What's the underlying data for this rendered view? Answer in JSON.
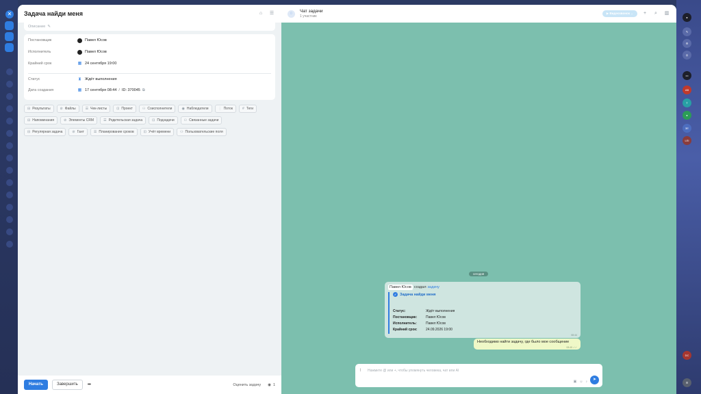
{
  "task": {
    "title": "Задача найди меня",
    "description_label": "Описание",
    "fields": {
      "creator_label": "Постановщик",
      "creator_value": "Павел Юсов",
      "assignee_label": "Исполнитель",
      "assignee_value": "Павел Юсов",
      "deadline_label": "Крайний срок",
      "deadline_value": "24 сентября 19:00",
      "status_label": "Статус",
      "status_value": "Ждёт выполнения",
      "created_label": "Дата создания",
      "created_value": "17 сентября 08:44",
      "id_value": "ID: 370045"
    },
    "chips_row1": [
      "Результаты",
      "Файлы",
      "Чек-листы",
      "Проект",
      "Соисполнители",
      "Наблюдатели",
      "Поток",
      "Теги"
    ],
    "chips_row2": [
      "Напоминания",
      "Элементы CRM",
      "Родительская задача",
      "Подзадачи",
      "Связанные задачи"
    ],
    "chips_row3": [
      "Регулярная задача",
      "Гант",
      "Планирование сроков",
      "Учёт времени",
      "Пользовательские поля"
    ],
    "footer": {
      "start_label": "Начать",
      "finish_label": "Завершить",
      "rate_label": "Оценить задачу",
      "views_count": "1"
    }
  },
  "chat": {
    "title": "Чат задачи",
    "subtitle": "1 участник",
    "video_label": "Видеозвонок",
    "date_label": "сегодня",
    "system_message": {
      "author": "Павел Юсов",
      "action": "создал",
      "link": "задачу",
      "task_title": "Задача найди меня",
      "rows": [
        {
          "key": "Статус:",
          "value": "Ждёт выполнения"
        },
        {
          "key": "Постановщик:",
          "value": "Павел Юсов"
        },
        {
          "key": "Исполнитель:",
          "value": "Павел Юсов"
        },
        {
          "key": "Крайний срок:",
          "value": "24.09.2026 19:00"
        }
      ],
      "time": "08:44"
    },
    "outgoing_message": {
      "text": "Необходимо найти задачу, где было мое сообщение",
      "time": "08:45"
    },
    "composer_placeholder": "Нажмите @ или +, чтобы упомянуть человека, чат или AI"
  },
  "right_rail": {
    "avatars": [
      "AB",
      "T",
      "3E",
      "LEI",
      "DC"
    ]
  }
}
